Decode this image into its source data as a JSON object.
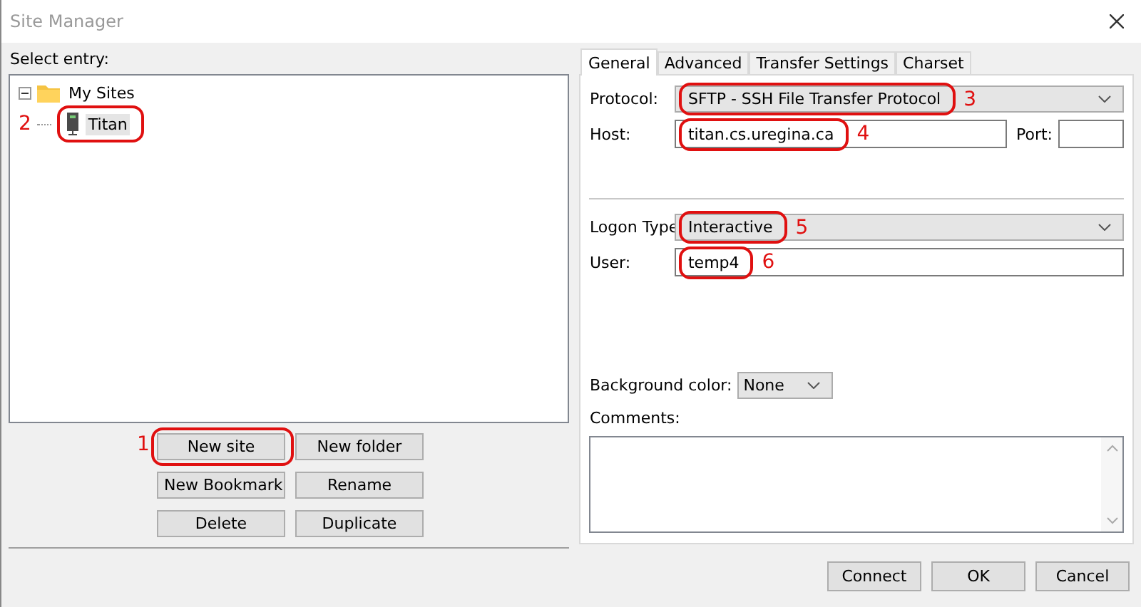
{
  "window": {
    "title": "Site Manager"
  },
  "select_label": "Select entry:",
  "tree": [
    {
      "label": "My Sites",
      "kind": "folder",
      "expanded": true,
      "selected": false,
      "children": [
        {
          "label": "Titan",
          "kind": "server",
          "selected": true,
          "callout": "2"
        }
      ]
    }
  ],
  "site_buttons": [
    {
      "label": "New site",
      "callout": "1"
    },
    {
      "label": "New folder"
    },
    {
      "label": "New Bookmark"
    },
    {
      "label": "Rename"
    },
    {
      "label": "Delete"
    },
    {
      "label": "Duplicate"
    }
  ],
  "tabs": [
    {
      "label": "General",
      "selected": true
    },
    {
      "label": "Advanced",
      "selected": false
    },
    {
      "label": "Transfer Settings",
      "selected": false
    },
    {
      "label": "Charset",
      "selected": false
    }
  ],
  "protocol": {
    "label": "Protocol:",
    "value": "SFTP - SSH File Transfer Protocol",
    "callout": "3"
  },
  "host": {
    "label": "Host:",
    "value": "titan.cs.uregina.ca",
    "callout": "4"
  },
  "port": {
    "label": "Port:"
  },
  "logon_type": {
    "label": "Logon Type",
    "value": "Interactive",
    "callout": "5"
  },
  "user": {
    "label": "User:",
    "value": "temp4",
    "callout": "6"
  },
  "background_color": {
    "label": "Background color:",
    "value": "None"
  },
  "comments": {
    "label": "Comments:"
  },
  "buttons": [
    "Connect",
    "OK",
    "Cancel"
  ]
}
